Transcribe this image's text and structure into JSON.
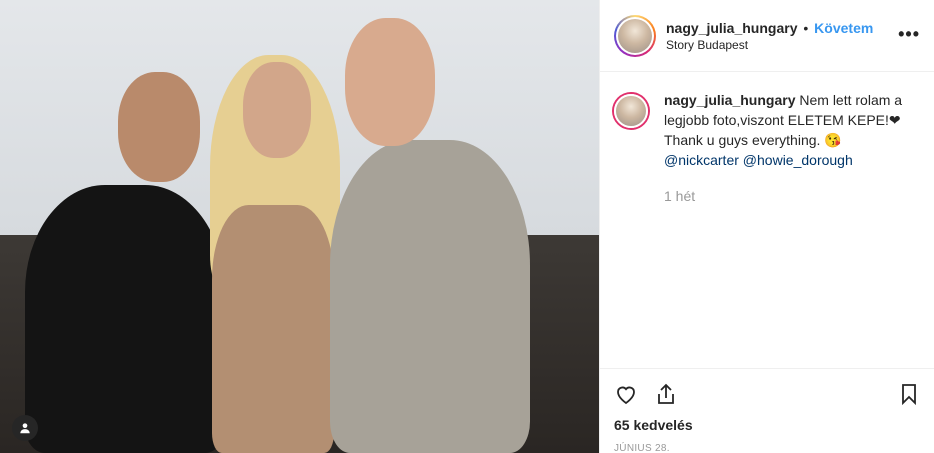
{
  "post": {
    "username": "nagy_julia_hungary",
    "separator": "•",
    "follow_label": "Követem",
    "location": "Story Budapest",
    "more_label": "•••"
  },
  "caption": {
    "username": "nagy_julia_hungary",
    "text_part1": "Nem lett rolam a legjobb foto,viszont ELETEM KEPE!❤",
    "text_part2": "Thank u guys everything. 😘",
    "mention1": "@nickcarter",
    "mention2": "@howie_dorough",
    "time": "1 hét"
  },
  "footer": {
    "likes": "65 kedvelés",
    "date": "JÚNIUS 28."
  },
  "icons": [
    "user-tag-icon",
    "heart-icon",
    "share-icon",
    "bookmark-icon"
  ],
  "colors": {
    "follow": "#3897f0",
    "mention": "#003569",
    "muted": "#999999"
  }
}
